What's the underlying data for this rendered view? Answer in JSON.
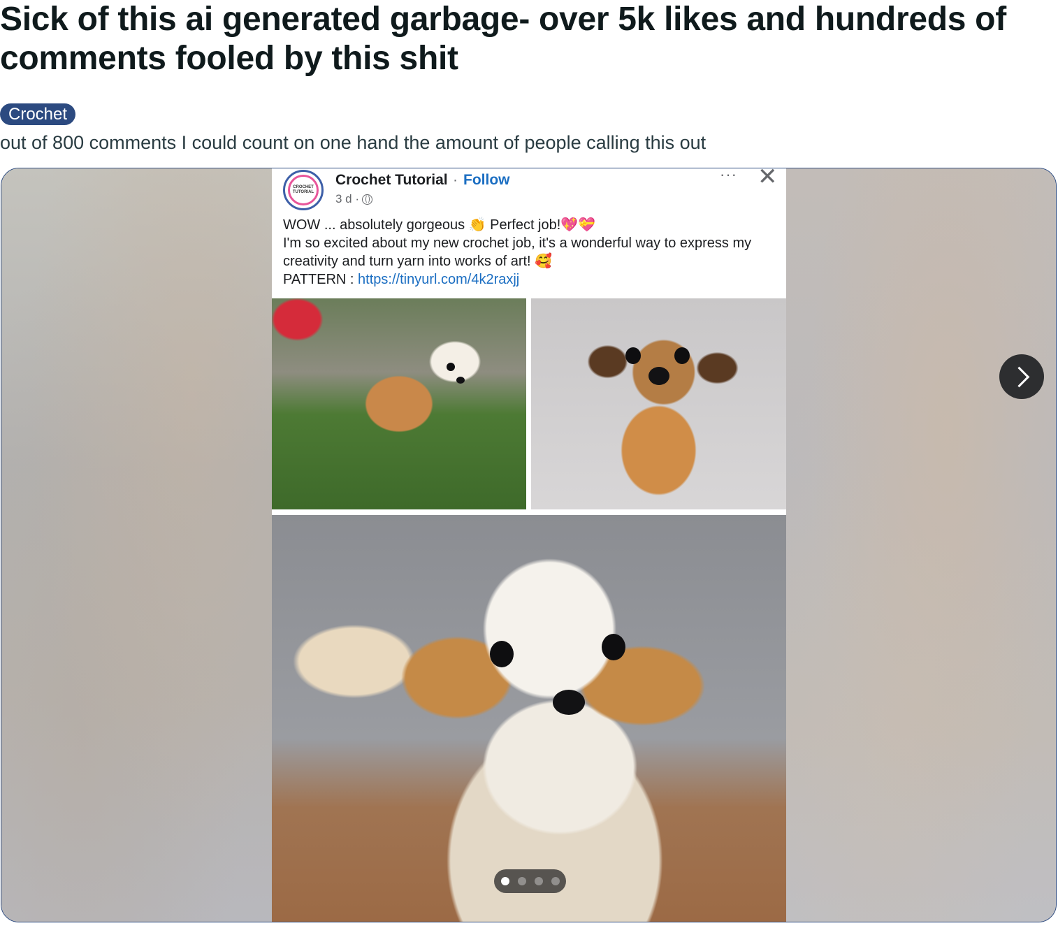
{
  "post": {
    "title": "Sick of this ai generated garbage- over 5k likes and hundreds of comments fooled by this shit",
    "flair": "Crochet",
    "body": "out of 800 comments I could count on one hand the amount of people calling this out"
  },
  "embedded_post": {
    "avatar_text": [
      "CROCHET",
      "TUTORIAL"
    ],
    "page_name": "Crochet Tutorial",
    "separator": "·",
    "follow_label": "Follow",
    "time": "3 d ·",
    "more_label": "···",
    "close_label": "✕",
    "caption_line1": "WOW ... absolutely gorgeous",
    "emoji_clap": "👏",
    "caption_line1b": "Perfect job!",
    "emoji_heart1": "💖",
    "emoji_heart2": "💝",
    "caption_line2": "I'm so excited about my new crochet job, it's a wonderful way to express my creativity and turn yarn into works of art!",
    "emoji_blush": "🥰",
    "pattern_label": "PATTERN :",
    "pattern_link": "https://tinyurl.com/4k2raxjj"
  },
  "gallery": {
    "current_slide": 1,
    "slide_count": 4
  },
  "icons": {
    "next": "chevron-right-icon",
    "globe": "globe-icon",
    "more": "more-icon",
    "close": "close-icon"
  },
  "colors": {
    "flair_bg": "#2c4a80",
    "link": "#1b6ec2",
    "border": "#2c4a80"
  }
}
